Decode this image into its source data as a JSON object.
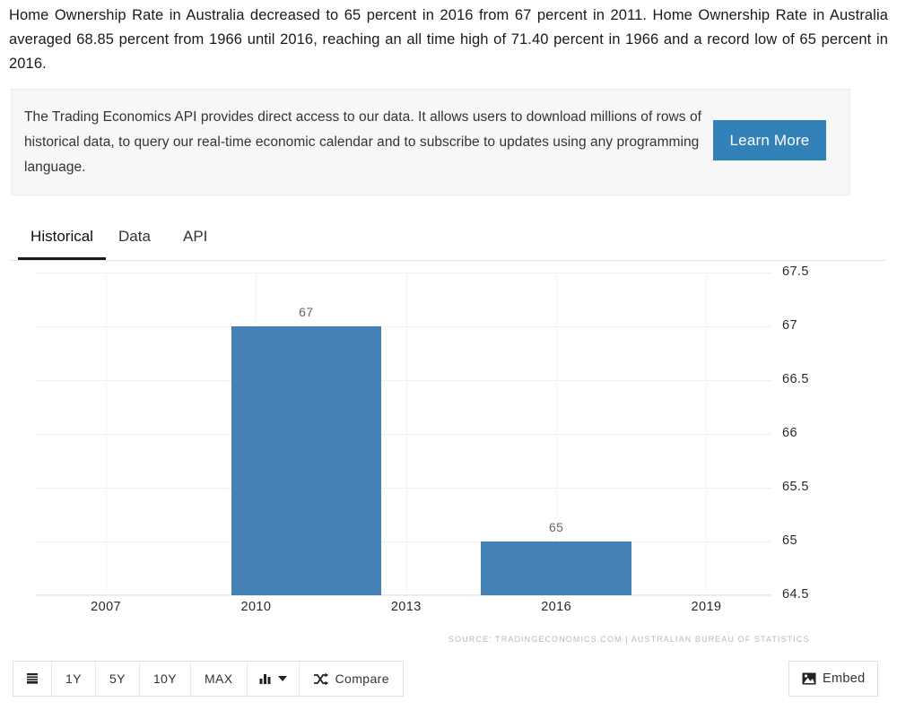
{
  "intro": {
    "paragraph": "Home Ownership Rate in Australia decreased to 65 percent in 2016 from 67 percent in 2011. Home Ownership Rate in Australia averaged 68.85 percent from 1966 until 2016, reaching an all time high of 71.40 percent in 1966 and a record low of 65 percent in 2016."
  },
  "api_box": {
    "text": "The Trading Economics API provides direct access to our data. It allows users to download millions of rows of historical data, to query our real-time economic calendar and to subscribe to updates using any programming language.",
    "button_label": "Learn More",
    "button_color": "#3281b8"
  },
  "tabs": [
    {
      "label": "Historical",
      "active": true
    },
    {
      "label": "Data",
      "active": false
    },
    {
      "label": "API",
      "active": false
    }
  ],
  "toolbar": {
    "list_icon": "list-icon",
    "ranges": [
      "1Y",
      "5Y",
      "10Y",
      "MAX"
    ],
    "chart_type_icon": "bar-chart-icon",
    "chart_type_caret": "chevron-down-icon",
    "compare_icon": "shuffle-icon",
    "compare_label": "Compare",
    "embed_icon": "image-icon",
    "embed_label": "Embed"
  },
  "chart_data": {
    "type": "bar",
    "title": "",
    "xlabel": "",
    "ylabel": "",
    "categories": [
      "2011",
      "2016"
    ],
    "values": [
      67,
      65
    ],
    "bar_labels": [
      "67",
      "65"
    ],
    "ylim": [
      64.5,
      67.5
    ],
    "yticks": [
      "67.5",
      "67",
      "66.5",
      "66",
      "65.5",
      "65",
      "64.5"
    ],
    "ytick_values": [
      67.5,
      67,
      66.5,
      66,
      65.5,
      65,
      64.5
    ],
    "xticks": [
      "2007",
      "2010",
      "2013",
      "2016",
      "2019"
    ],
    "xtick_values": [
      2007,
      2010,
      2013,
      2016,
      2019
    ],
    "xlim": [
      2005.6,
      2020.3
    ],
    "grid": true,
    "legend": null,
    "bar_color": "#4581b4",
    "source": "SOURCE: TRADINGECONOMICS.COM | AUSTRALIAN BUREAU OF STATISTICS"
  }
}
